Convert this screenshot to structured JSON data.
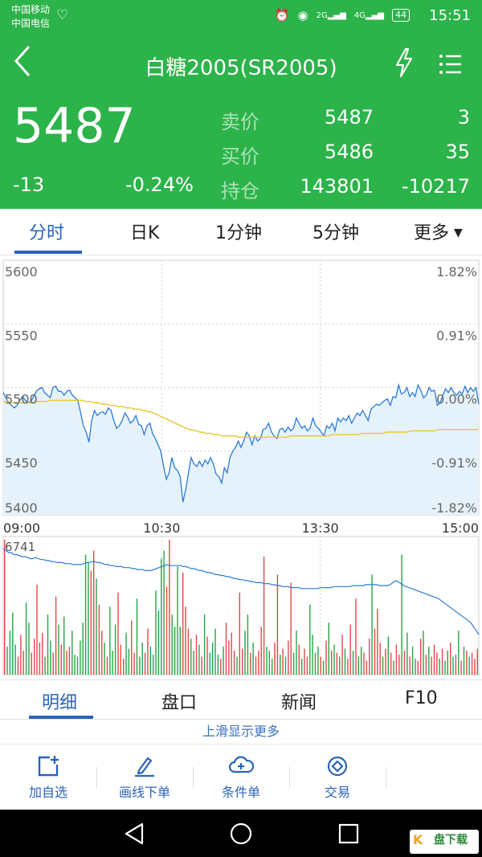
{
  "status_bar": {
    "carrier1": "中国移动",
    "carrier2": "中国电信",
    "net1": "2G",
    "net2": "4G",
    "battery": "44",
    "time": "15:51"
  },
  "header": {
    "title": "白糖2005(SR2005)",
    "last_price": "5487",
    "change": "-13",
    "change_pct": "-0.24%",
    "sell": {
      "label": "卖价",
      "price": "5487",
      "volume": "3"
    },
    "buy": {
      "label": "买价",
      "price": "5486",
      "volume": "35"
    },
    "position": {
      "label": "持仓",
      "value": "143801",
      "change": "-10217"
    }
  },
  "tabs": {
    "timeshare": "分时",
    "daily_k": "日K",
    "one_min": "1分钟",
    "five_min": "5分钟",
    "more": "更多"
  },
  "colors": {
    "brand_green": "#2cb34a",
    "accent_blue": "#2c63b8",
    "price_line": "#2b7bd6",
    "avg_line": "#e8c531",
    "area_fill": "#e6f2fb",
    "vol_up": "#e04848",
    "vol_down": "#27a346"
  },
  "chart_data": {
    "type": "line",
    "title": "",
    "y_left_ticks": [
      "5600",
      "5550",
      "5500",
      "5450",
      "5400"
    ],
    "y_right_ticks": [
      "1.82%",
      "0.91%",
      "0.00%",
      "-0.91%",
      "-1.82%"
    ],
    "x_ticks": [
      "09:00",
      "10:30",
      "13:30",
      "15:00"
    ],
    "ylim": [
      5400,
      5600
    ],
    "prev_settlement": 5500,
    "price_series": [
      5496,
      5492,
      5488,
      5486,
      5484,
      5486,
      5490,
      5493,
      5490,
      5488,
      5489,
      5493,
      5497,
      5499,
      5500,
      5496,
      5494,
      5492,
      5500,
      5501,
      5497,
      5497,
      5494,
      5497,
      5498,
      5494,
      5492,
      5490,
      5480,
      5470,
      5465,
      5457,
      5474,
      5482,
      5478,
      5480,
      5481,
      5479,
      5484,
      5482,
      5474,
      5468,
      5470,
      5474,
      5480,
      5477,
      5472,
      5474,
      5478,
      5471,
      5470,
      5463,
      5470,
      5472,
      5464,
      5460,
      5455,
      5450,
      5438,
      5428,
      5433,
      5445,
      5437,
      5435,
      5430,
      5410,
      5420,
      5433,
      5445,
      5440,
      5438,
      5442,
      5438,
      5443,
      5440,
      5445,
      5440,
      5432,
      5430,
      5425,
      5437,
      5433,
      5445,
      5450,
      5453,
      5458,
      5453,
      5458,
      5465,
      5462,
      5455,
      5462,
      5458,
      5460,
      5467,
      5468,
      5472,
      5465,
      5462,
      5460,
      5467,
      5468,
      5465,
      5469,
      5466,
      5468,
      5476,
      5472,
      5468,
      5470,
      5466,
      5468,
      5476,
      5470,
      5468,
      5465,
      5462,
      5470,
      5468,
      5472,
      5466,
      5476,
      5473,
      5476,
      5474,
      5478,
      5472,
      5476,
      5480,
      5478,
      5482,
      5478,
      5474,
      5483,
      5485,
      5487,
      5486,
      5488,
      5490,
      5491,
      5486,
      5493,
      5492,
      5502,
      5495,
      5496,
      5500,
      5493,
      5496,
      5493,
      5502,
      5498,
      5492,
      5494,
      5500,
      5497,
      5498,
      5486,
      5488,
      5494,
      5499,
      5496,
      5500,
      5496,
      5494,
      5497,
      5495,
      5501,
      5496,
      5500,
      5497,
      5500,
      5487
    ],
    "avg_series": [
      5489,
      5489,
      5489,
      5488,
      5488,
      5488,
      5488,
      5488,
      5488,
      5488,
      5488,
      5488,
      5489,
      5489,
      5489,
      5489,
      5489,
      5490,
      5490,
      5490,
      5490,
      5490,
      5490,
      5490,
      5490,
      5490,
      5490,
      5490,
      5490,
      5490,
      5489,
      5489,
      5489,
      5488,
      5488,
      5488,
      5487,
      5487,
      5487,
      5486,
      5486,
      5486,
      5485,
      5485,
      5485,
      5484,
      5484,
      5484,
      5483,
      5483,
      5483,
      5482,
      5482,
      5481,
      5481,
      5480,
      5479,
      5478,
      5477,
      5476,
      5475,
      5474,
      5473,
      5472,
      5471,
      5470,
      5469,
      5468,
      5467,
      5467,
      5466,
      5466,
      5465,
      5465,
      5464,
      5464,
      5464,
      5463,
      5463,
      5463,
      5462,
      5462,
      5462,
      5462,
      5462,
      5462,
      5461,
      5461,
      5461,
      5461,
      5461,
      5461,
      5461,
      5461,
      5461,
      5461,
      5461,
      5461,
      5461,
      5461,
      5461,
      5461,
      5461,
      5461,
      5461,
      5462,
      5462,
      5462,
      5462,
      5462,
      5462,
      5462,
      5462,
      5462,
      5462,
      5462,
      5462,
      5462,
      5462,
      5462,
      5463,
      5463,
      5463,
      5463,
      5463,
      5463,
      5463,
      5463,
      5463,
      5463,
      5463,
      5464,
      5464,
      5464,
      5464,
      5464,
      5464,
      5464,
      5464,
      5464,
      5465,
      5465,
      5465,
      5465,
      5465,
      5465,
      5465,
      5465,
      5465,
      5466,
      5466,
      5466,
      5466,
      5466,
      5466,
      5466,
      5466,
      5466,
      5466,
      5467,
      5467,
      5467,
      5467,
      5467,
      5467,
      5467,
      5467,
      5467,
      5467,
      5467,
      5467,
      5467,
      5467,
      5467,
      5467
    ],
    "volume_max_label": "6741",
    "volume_max": 6741,
    "volume_series": [
      6741,
      1400,
      2200,
      3100,
      1500,
      900,
      2000,
      1200,
      3600,
      2600,
      1100,
      1800,
      4500,
      1600,
      2100,
      900,
      3000,
      1700,
      1100,
      3900,
      2500,
      1500,
      2900,
      1200,
      1400,
      2200,
      1000,
      900,
      1700,
      2600,
      6000,
      5600,
      5200,
      6200,
      4800,
      3500,
      2200,
      1600,
      900,
      3400,
      1200,
      2500,
      4100,
      1500,
      800,
      2100,
      1300,
      2700,
      1100,
      3800,
      900,
      1600,
      1100,
      2300,
      1400,
      1000,
      4200,
      3200,
      5800,
      6200,
      4400,
      6741,
      3000,
      2400,
      5400,
      2400,
      5100,
      3400,
      2300,
      1800,
      1200,
      2000,
      1500,
      900,
      3000,
      1900,
      1100,
      1600,
      2300,
      1000,
      800,
      1400,
      2600,
      1700,
      2100,
      1200,
      900,
      4100,
      1300,
      2200,
      3000,
      1100,
      1600,
      900,
      1200,
      2400,
      5900,
      1400,
      1200,
      800,
      1600,
      5000,
      1000,
      1300,
      900,
      1700,
      4600,
      1100,
      2200,
      1500,
      800,
      1300,
      900,
      3500,
      2000,
      1100,
      1400,
      900,
      700,
      1700,
      2600,
      1200,
      1500,
      1100,
      900,
      2000,
      1300,
      800,
      2500,
      1200,
      3800,
      900,
      1400,
      1100,
      700,
      1800,
      5000,
      2300,
      3300,
      1600,
      900,
      1300,
      1900,
      1100,
      700,
      1500,
      1000,
      6000,
      1200,
      2100,
      900,
      1400,
      800,
      700,
      1800,
      2200,
      1000,
      1400,
      900,
      1500,
      1100,
      800,
      1300,
      700,
      1200,
      1600,
      900,
      1000,
      2200,
      700,
      1400,
      1200,
      900,
      1100,
      800,
      1300
    ],
    "volume_avg_series": [
      6300,
      6200,
      6100,
      6100,
      6000,
      6000,
      5950,
      5900,
      5900,
      5850,
      5800,
      5800,
      5850,
      5800,
      5750,
      5750,
      5700,
      5700,
      5650,
      5650,
      5600,
      5600,
      5600,
      5550,
      5550,
      5550,
      5500,
      5500,
      5500,
      5500,
      5550,
      5600,
      5600,
      5650,
      5650,
      5600,
      5600,
      5550,
      5500,
      5500,
      5450,
      5450,
      5400,
      5400,
      5400,
      5350,
      5350,
      5350,
      5300,
      5300,
      5250,
      5250,
      5250,
      5200,
      5200,
      5200,
      5250,
      5300,
      5350,
      5400,
      5450,
      5500,
      5450,
      5450,
      5450,
      5450,
      5450,
      5400,
      5400,
      5350,
      5300,
      5300,
      5250,
      5200,
      5200,
      5150,
      5100,
      5100,
      5050,
      5000,
      5000,
      4950,
      4950,
      4900,
      4900,
      4850,
      4800,
      4800,
      4750,
      4750,
      4700,
      4700,
      4650,
      4650,
      4600,
      4600,
      4600,
      4550,
      4550,
      4550,
      4500,
      4500,
      4450,
      4450,
      4400,
      4400,
      4400,
      4350,
      4350,
      4350,
      4350,
      4300,
      4300,
      4300,
      4300,
      4300,
      4300,
      4300,
      4350,
      4350,
      4350,
      4350,
      4350,
      4400,
      4400,
      4400,
      4400,
      4400,
      4400,
      4400,
      4450,
      4450,
      4450,
      4450,
      4450,
      4500,
      4500,
      4500,
      4500,
      4500,
      4450,
      4450,
      4450,
      4450,
      4500,
      4600,
      4700,
      4650,
      4550,
      4450,
      4400,
      4350,
      4300,
      4250,
      4200,
      4150,
      4100,
      4050,
      4000,
      3950,
      3900,
      3850,
      3800,
      3700,
      3600,
      3500,
      3400,
      3300,
      3200,
      3100,
      3000,
      2900,
      2800,
      2700,
      2600,
      2400,
      2200,
      2000
    ]
  },
  "bottom_tabs": {
    "detail": "明细",
    "orderbook": "盘口",
    "news": "新闻",
    "f10": "F10"
  },
  "more_hint": "上滑显示更多",
  "toolbar": {
    "add_watch": "加自选",
    "draw_order": "画线下单",
    "condition_order": "条件单",
    "trade": "交易"
  },
  "watermark": {
    "mark": "K",
    "text": "盘下载"
  }
}
